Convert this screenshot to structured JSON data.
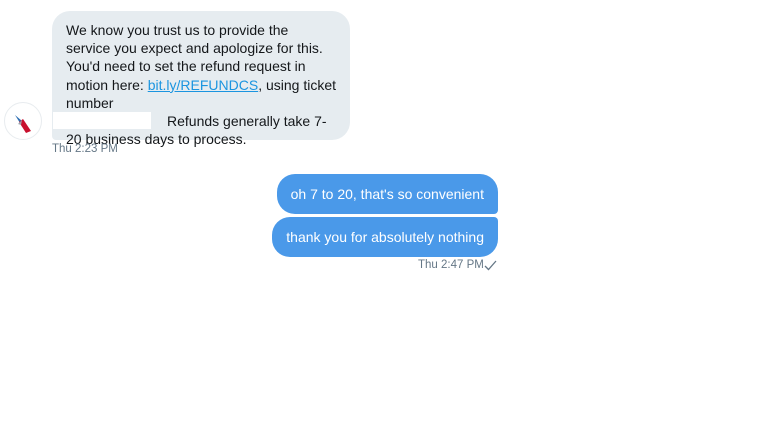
{
  "incoming": {
    "sender_avatar_icon": "airline-logo-icon",
    "text_before_link": "We know you trust us to provide the service you expect and apologize for this. You'd need to set the refund request in motion here: ",
    "link_text": "bit.ly/REFUNDCS",
    "text_after_link": ", using ticket number",
    "text_after_redaction": "Refunds generally take 7-20 business days to process.",
    "timestamp": "Thu 2:23 PM"
  },
  "outgoing": {
    "messages": [
      {
        "text": "oh 7 to 20, that's so convenient"
      },
      {
        "text": "thank you for absolutely nothing"
      }
    ],
    "timestamp": "Thu 2:47 PM",
    "status_icon": "checkmark-icon"
  },
  "colors": {
    "incoming_bubble": "#e6ecf0",
    "outgoing_bubble": "#4a99e9",
    "link": "#1b95e0",
    "timestamp": "#657786"
  }
}
